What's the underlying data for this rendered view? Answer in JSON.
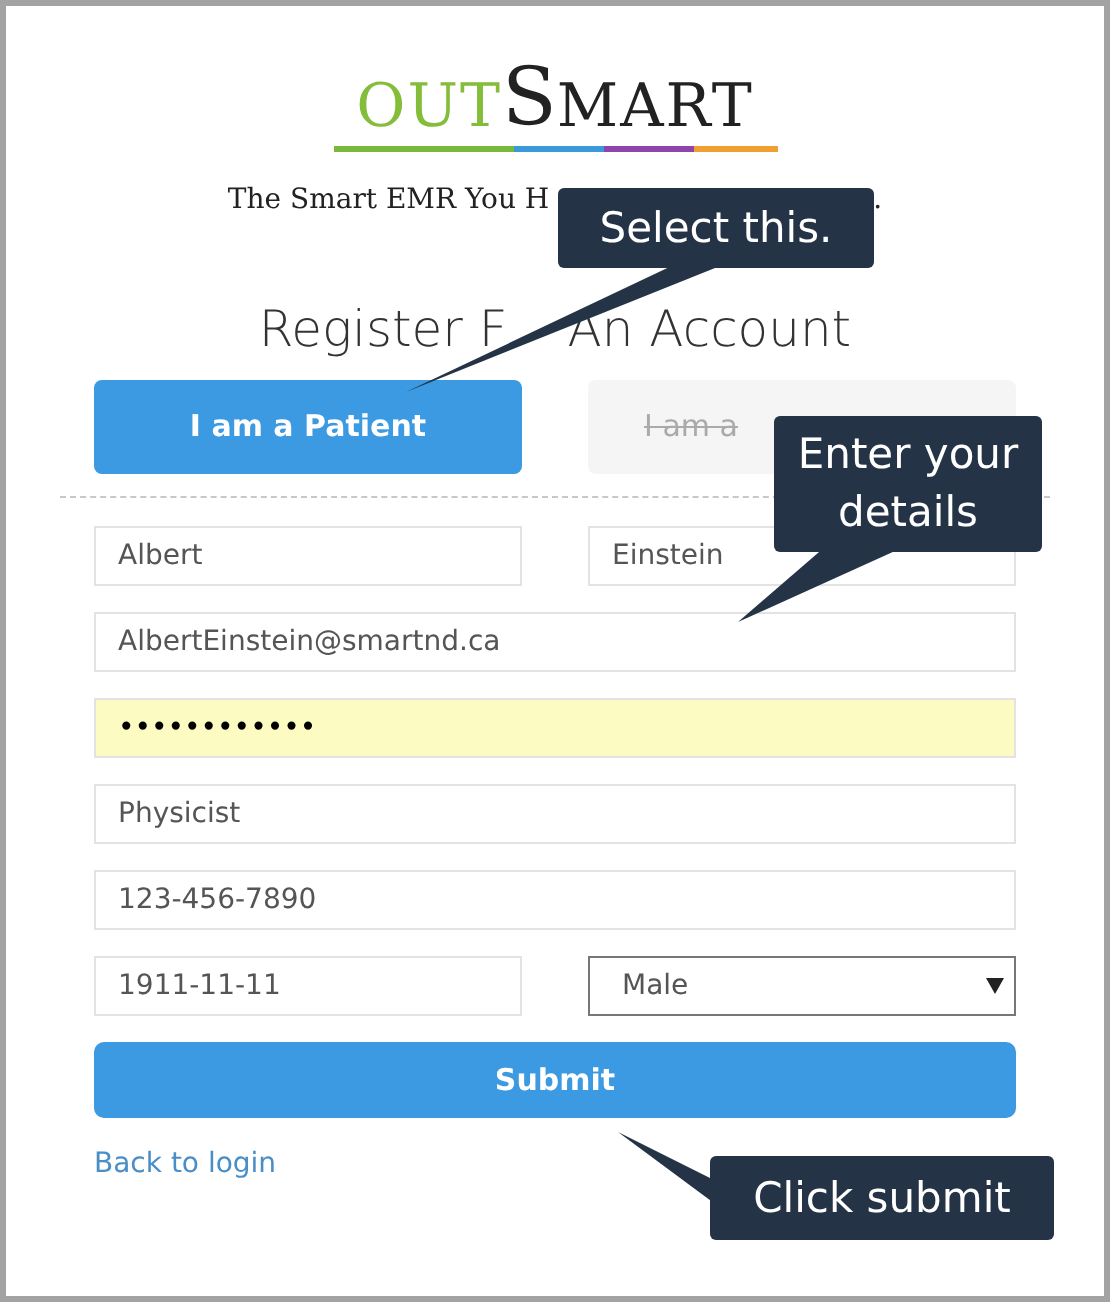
{
  "logo": {
    "part_1": "OUT",
    "part_2": "S",
    "part_3": "MART"
  },
  "tagline": {
    "visible_start": "The Smart EMR You H",
    "visible_end": "."
  },
  "heading": {
    "visible_start": "Register F",
    "visible_end": "An Account"
  },
  "roles": [
    {
      "label": "I am a Patient",
      "selected": true
    },
    {
      "label": "I am a",
      "selected": false
    }
  ],
  "form": {
    "first_name": "Albert",
    "last_name": "Einstein",
    "email": "AlbertEinstein@smartnd.ca",
    "password": "••••••••••••",
    "occupation": "Physicist",
    "phone": "123-456-7890",
    "birth_date": "1911-11-11",
    "gender": "Male"
  },
  "submit_button": "Submit",
  "back_link": "Back to login",
  "callouts": [
    {
      "text": "Select this."
    },
    {
      "text": "Enter your details"
    },
    {
      "text": "Click submit"
    }
  ]
}
